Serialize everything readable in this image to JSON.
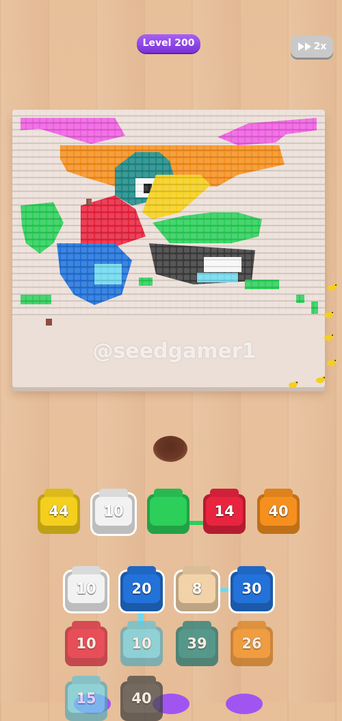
{
  "hud": {
    "level_label": "Level 200",
    "speed_label": "2x",
    "speed_icon": "fast-forward-icon"
  },
  "board": {
    "watermark": "@seedgamer1"
  },
  "colors": {
    "yellow": "#f5cf1e",
    "white": "#f2f2f2",
    "green": "#2ccf5a",
    "red": "#e8243f",
    "orange": "#f5901f",
    "blue": "#2272d9",
    "beige": "#f2d2a8",
    "cyan": "#6fd9ee",
    "teal": "#1e8a86",
    "gray": "#4b4b4b",
    "pink": "#ee5fe0",
    "purple": "#a155f0"
  },
  "queue": [
    {
      "value": "44",
      "color": "yellow"
    },
    {
      "value": "10",
      "color": "white"
    },
    {
      "value": "",
      "color": "green"
    },
    {
      "value": "14",
      "color": "red"
    },
    {
      "value": "40",
      "color": "orange"
    }
  ],
  "grid": [
    {
      "value": "10",
      "color": "white"
    },
    {
      "value": "20",
      "color": "blue"
    },
    {
      "value": "8",
      "color": "beige"
    },
    {
      "value": "30",
      "color": "blue"
    },
    {
      "value": "10",
      "color": "red"
    },
    {
      "value": "10",
      "color": "cyan"
    },
    {
      "value": "39",
      "color": "teal"
    },
    {
      "value": "26",
      "color": "orange"
    },
    {
      "value": "15",
      "color": "cyan"
    },
    {
      "value": "40",
      "color": "gray"
    }
  ]
}
